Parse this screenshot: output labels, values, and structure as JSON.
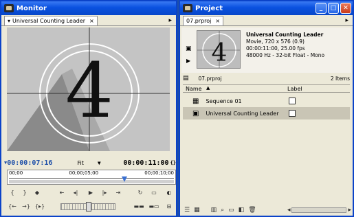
{
  "monitor": {
    "title": "Monitor",
    "tab_label": "Universal Counting Leader",
    "countdown_digit": "4",
    "current_timecode": "00:00:07:16",
    "zoom": "Fit",
    "duration_timecode": "00:00:11:00",
    "ruler_start": "00;00",
    "ruler_mid": "00;00;05;00",
    "ruler_end": "00;00;10;00"
  },
  "project": {
    "title": "Project",
    "tab_label": "07.prproj",
    "preview_digit": "4",
    "clip_name": "Universal Counting Leader",
    "clip_type": "Movie, 720 x 576 (0.9)",
    "clip_duration": "00:00:11:00, 25.00 fps",
    "clip_audio": "48000 Hz - 32-bit Float - Mono",
    "file_name": "07.prproj",
    "item_count": "2 Items",
    "col_name": "Name",
    "col_label": "Label",
    "items": [
      {
        "name": "Sequence 01",
        "icon": "sequence-icon"
      },
      {
        "name": "Universal Counting Leader",
        "icon": "film-clip-icon"
      }
    ]
  }
}
